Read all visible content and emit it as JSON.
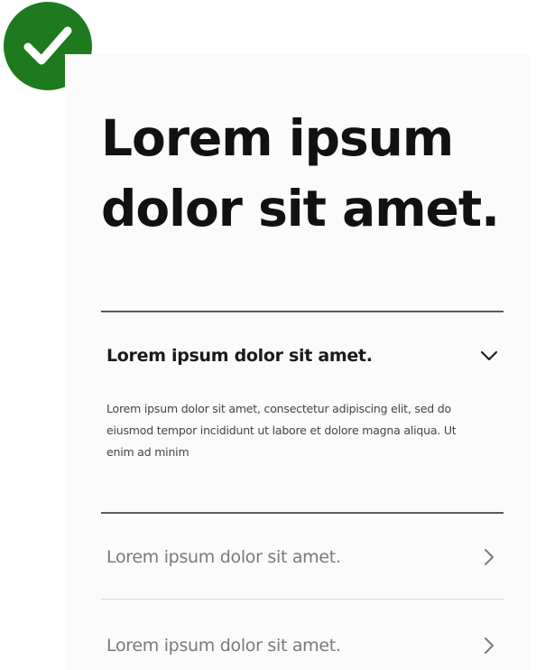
{
  "badge": {
    "icon": "checkmark-icon",
    "color": "#1e7a1e"
  },
  "card": {
    "headline": "Lorem ipsum dolor sit amet.",
    "accordion": [
      {
        "title": "Lorem ipsum dolor sit amet.",
        "state": "expanded",
        "icon": "chevron-down-icon",
        "body": "Lorem ipsum dolor sit amet, consectetur adipiscing elit, sed do eiusmod tempor incididunt ut labore et dolore magna aliqua. Ut enim ad minim"
      },
      {
        "title": "Lorem ipsum dolor sit amet.",
        "state": "collapsed",
        "icon": "chevron-right-icon"
      },
      {
        "title": "Lorem ipsum dolor sit amet.",
        "state": "collapsed",
        "icon": "chevron-right-icon"
      }
    ]
  }
}
